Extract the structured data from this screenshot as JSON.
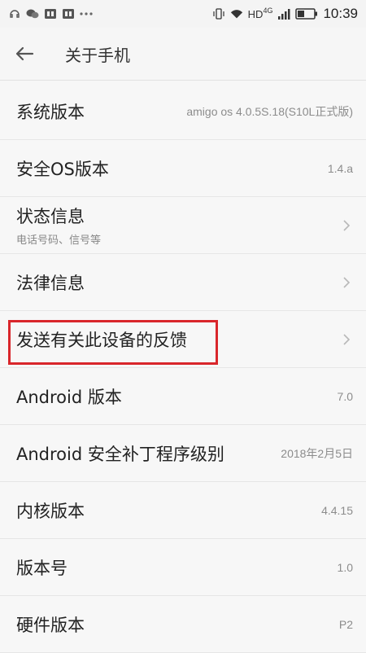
{
  "status_bar": {
    "left_icons": [
      "headset-icon",
      "wechat-icon",
      "qq-icon",
      "qq-icon",
      "more-dots-icon"
    ],
    "network_label": "HD",
    "network_gen": "4G",
    "time": "10:39"
  },
  "app_bar": {
    "title": "关于手机"
  },
  "list": [
    {
      "title": "系统版本",
      "value": "amigo os 4.0.5S.18(S10L正式版)"
    },
    {
      "title": "安全OS版本",
      "value": "1.4.a"
    },
    {
      "title": "状态信息",
      "subtitle": "电话号码、信号等"
    },
    {
      "title": "法律信息"
    },
    {
      "title": "发送有关此设备的反馈"
    },
    {
      "title": "Android 版本",
      "value": "7.0"
    },
    {
      "title": "Android 安全补丁程序级别",
      "value": "2018年2月5日"
    },
    {
      "title": "内核版本",
      "value": "4.4.15"
    },
    {
      "title": "版本号",
      "value": "1.0"
    },
    {
      "title": "硬件版本",
      "value": "P2"
    }
  ],
  "colors": {
    "highlight": "#d9262b",
    "background": "#f7f7f7"
  }
}
